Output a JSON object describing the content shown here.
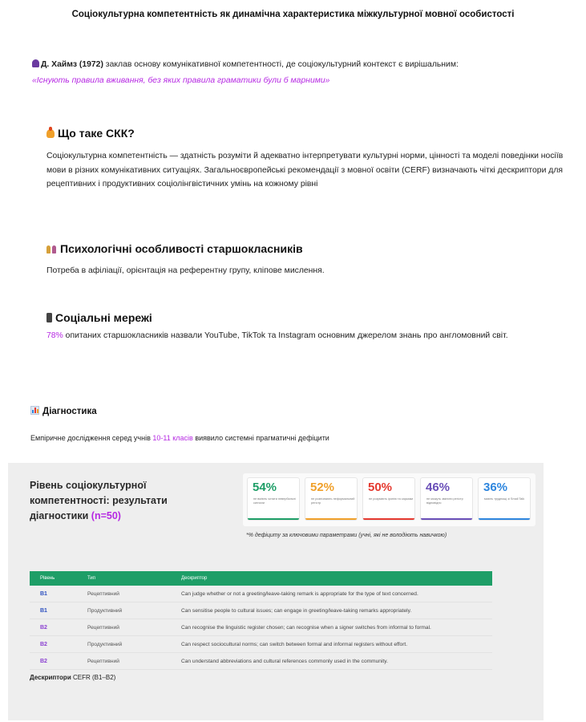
{
  "title": "Соціокультурна компетентність як динамічна характеристика міжкультурної мовної особистості",
  "haims": {
    "author": "Д. Хаймз (1972)",
    "text": " заклав основу комунікативної компетентності, де соціокультурний контекст є вирішальним:",
    "quote": "«Існують правила вживання, без яких правила граматики були б марними»"
  },
  "sections": {
    "skk": {
      "heading": "Що таке СКК?",
      "body": "Соціокультурна компетентність — здатність розуміти й адекватно інтерпретувати культурні норми, цінності та моделі поведінки носіїв мови в різних комунікативних ситуаціях. Загальноєвропейські рекомендації з мовної освіти (CERF) визначають чіткі дескриптори для рецептивних і продуктивних соціолінгвістичних умінь на кожному рівні"
    },
    "psych": {
      "heading": "Психологічні особливості старшокласників",
      "body": "Потреба в афіліації, орієнтація на референтну групу, кліпове мислення."
    },
    "social": {
      "heading": "Соціальні мережі",
      "pct": "78%",
      "body": " опитаних старшокласників назвали YouTube, TikTok та Instagram основним джерелом знань про англомовний світ."
    },
    "diag": {
      "heading": "Діагностика",
      "body_before": "Емпіричне дослідження серед учнів ",
      "highlight": "10-11 класів",
      "body_after": " виявило системні прагматичні дефіцити"
    }
  },
  "panel": {
    "title": "Рівень соціокультурної компетентності: результати діагностики",
    "sample": "(n=50)",
    "cards": [
      {
        "value": "54%",
        "desc": "не вміють читати невербальні сигнали",
        "color": "#1e9e67"
      },
      {
        "value": "52%",
        "desc": "не розпізнають неформальний регістр",
        "color": "#f0a02a"
      },
      {
        "value": "50%",
        "desc": "не розуміють іронію та сарказм",
        "color": "#e5392f"
      },
      {
        "value": "46%",
        "desc": "не можуть змінити регістр відповідно",
        "color": "#6a4fb8"
      },
      {
        "value": "36%",
        "desc": "мають труднощі зі Small Talk",
        "color": "#2e86de"
      }
    ],
    "footnote": "*% дефіциту за ключовими параметрами (учні, які не володіють навичкою)",
    "table": {
      "headers": [
        "Рівень",
        "Тип",
        "Дескриптор"
      ],
      "rows": [
        {
          "level": "B1",
          "type": "Рецептивний",
          "descriptor": "Can judge whether or not a greeting/leave-taking remark is appropriate for the type of text concerned.",
          "color": "#2b4fbf"
        },
        {
          "level": "B1",
          "type": "Продуктивний",
          "descriptor": "Can sensitise people to cultural issues; can engage in greeting/leave-taking remarks appropriately.",
          "color": "#2b4fbf"
        },
        {
          "level": "B2",
          "type": "Рецептивний",
          "descriptor": "Can recognise the linguistic register chosen; can recognise when a signer switches from informal to formal.",
          "color": "#8a3fd1"
        },
        {
          "level": "B2",
          "type": "Продуктивний",
          "descriptor": "Can respect sociocultural norms; can switch between formal and informal registers without effort.",
          "color": "#8a3fd1"
        },
        {
          "level": "B2",
          "type": "Рецептивний",
          "descriptor": "Can understand abbreviations and cultural references commonly used in the community.",
          "color": "#8a3fd1"
        }
      ]
    },
    "caption_bold": "Дескриптори",
    "caption_rest": " CEFR (B1–B2)"
  }
}
